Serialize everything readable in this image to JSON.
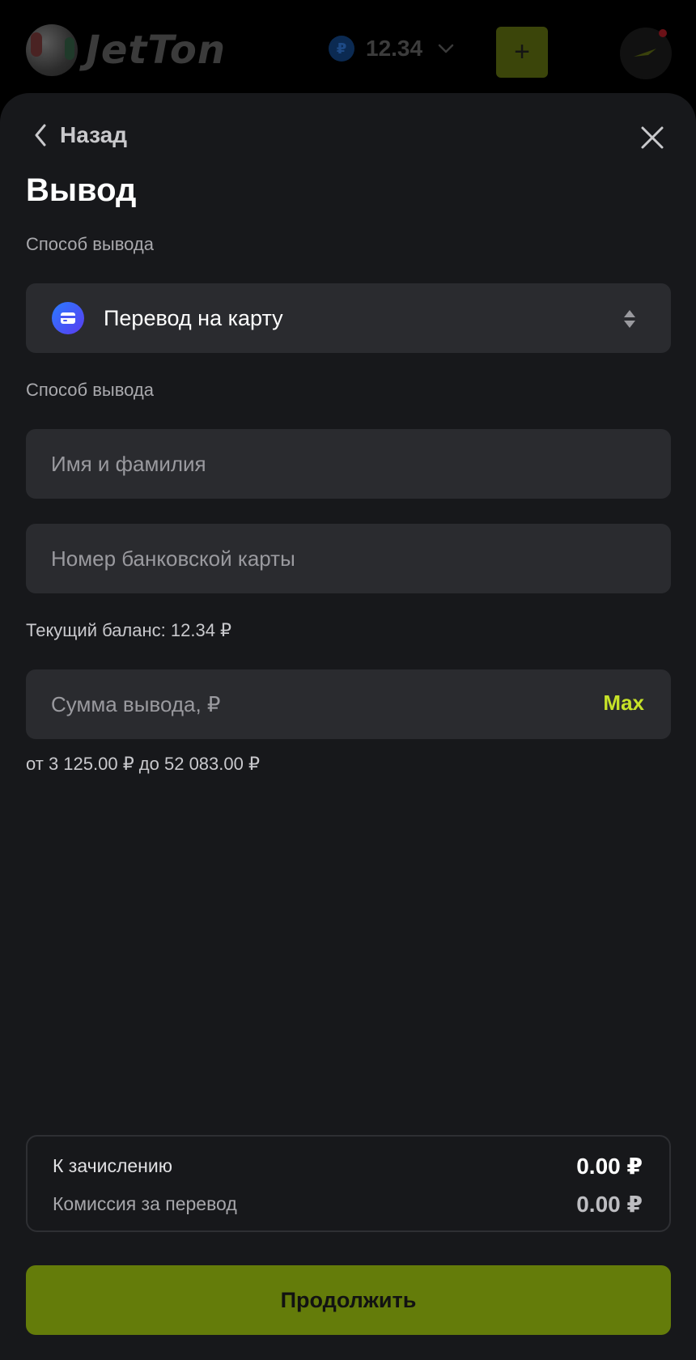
{
  "header": {
    "logo_text": "JetTon",
    "currency_symbol": "₽",
    "balance": "12.34",
    "add_label": "+"
  },
  "modal": {
    "back_label": "Назад",
    "title": "Вывод",
    "method_label": "Способ вывода",
    "method_value": "Перевод на карту",
    "details_label": "Способ вывода",
    "name_placeholder": "Имя и фамилия",
    "card_placeholder": "Номер банковской карты",
    "current_balance": "Текущий баланс: 12.34 ₽",
    "amount_placeholder": "Сумма вывода, ₽",
    "max_label": "Max",
    "limits": "от 3 125.00 ₽ до 52 083.00 ₽",
    "summary": {
      "credit_label": "К зачислению",
      "credit_value": "0.00 ₽",
      "fee_label": "Комиссия за перевод",
      "fee_value": "0.00 ₽"
    },
    "continue_label": "Продолжить"
  },
  "colors": {
    "accent": "#c6e228",
    "button": "#647c0a",
    "sheet_bg": "#17181b",
    "field_bg": "#2a2b2f"
  },
  "icons": {
    "back": "chevron-left-icon",
    "close": "close-icon",
    "method": "card-icon",
    "select": "sort-arrows-icon",
    "balance_dropdown": "chevron-down-icon"
  }
}
